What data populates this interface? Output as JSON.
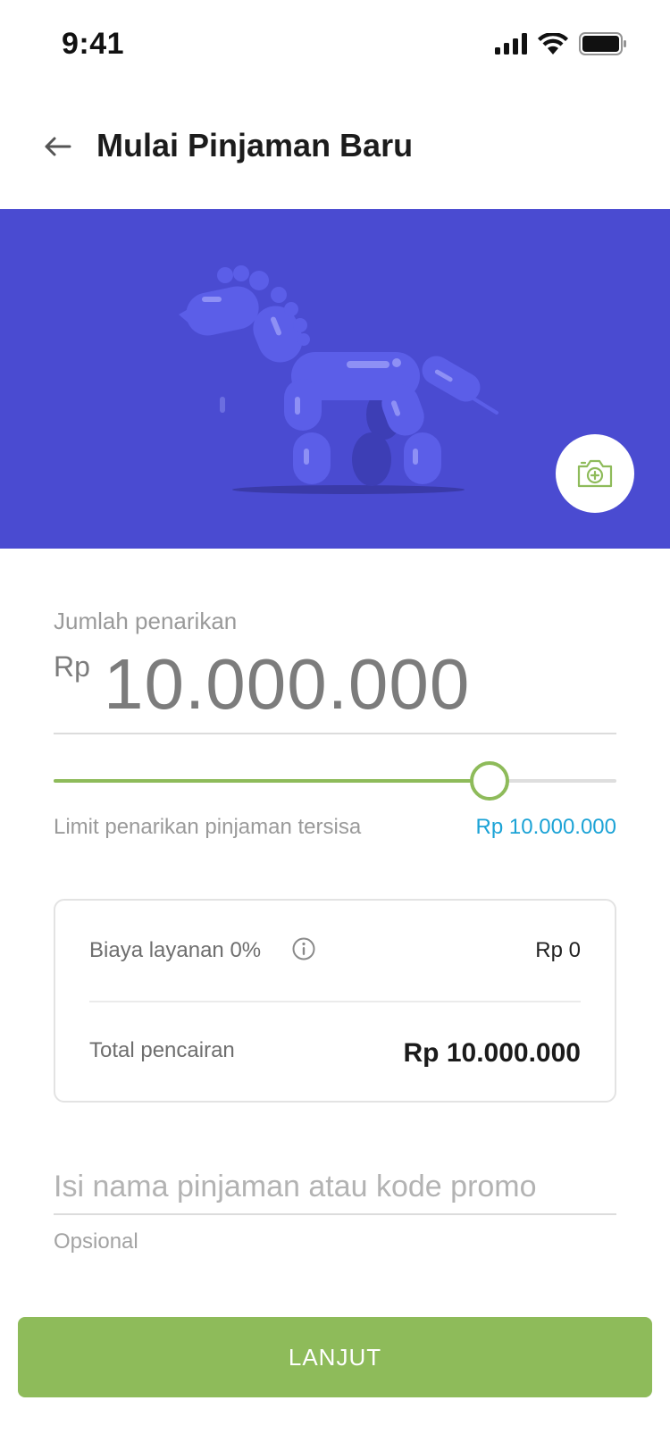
{
  "status_bar": {
    "time": "9:41"
  },
  "header": {
    "title": "Mulai Pinjaman Baru"
  },
  "hero": {
    "background": "#4a4bd1",
    "illustration": "balloon-horse",
    "camera_icon": "camera-plus-icon"
  },
  "amount": {
    "label": "Jumlah penarikan",
    "currency": "Rp",
    "value": "10.000.000",
    "slider_fraction": 0.775
  },
  "limit": {
    "label": "Limit penarikan pinjaman tersisa",
    "value": "Rp 10.000.000"
  },
  "fees": {
    "service_label": "Biaya layanan 0%",
    "service_value": "Rp 0",
    "total_label": "Total pencairan",
    "total_value": "Rp 10.000.000"
  },
  "promo": {
    "placeholder": "Isi nama pinjaman atau kode promo",
    "helper": "Opsional"
  },
  "submit": {
    "label": "LANJUT"
  },
  "colors": {
    "accent": "#8ebb5a",
    "link": "#1ca3d6",
    "hero": "#4a4bd1"
  }
}
